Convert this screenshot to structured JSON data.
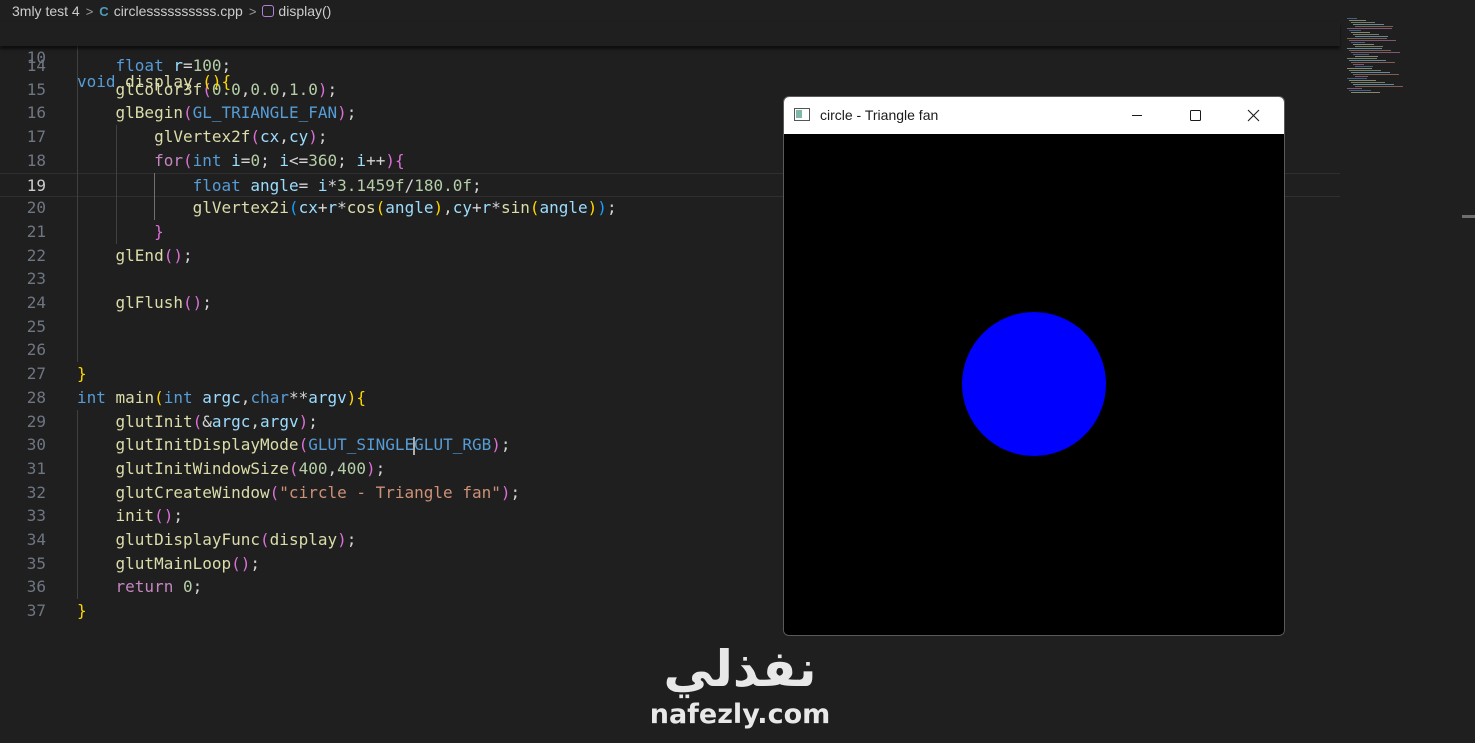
{
  "breadcrumb": {
    "folder": "3mly test 4",
    "file_icon": "C",
    "file": "circlessssssssss.cpp",
    "symbol": "display()"
  },
  "sticky": {
    "line_number": "10",
    "tokens": [
      {
        "t": "void",
        "c": "k"
      },
      {
        "t": " ",
        "c": "p"
      },
      {
        "t": "display",
        "c": "f"
      },
      {
        "t": " ",
        "c": "p"
      },
      {
        "t": "()",
        "c": "b1"
      },
      {
        "t": "{",
        "c": "b1"
      }
    ]
  },
  "editor": {
    "active_line": "19",
    "lines": [
      {
        "n": "14",
        "tokens": [
          {
            "t": "    ",
            "c": "p"
          },
          {
            "t": "float",
            "c": "k"
          },
          {
            "t": " ",
            "c": "p"
          },
          {
            "t": "r",
            "c": "v"
          },
          {
            "t": "=",
            "c": "p"
          },
          {
            "t": "100",
            "c": "n"
          },
          {
            "t": ";",
            "c": "p"
          }
        ]
      },
      {
        "n": "15",
        "tokens": [
          {
            "t": "    ",
            "c": "p"
          },
          {
            "t": "glColor3f",
            "c": "f"
          },
          {
            "t": "(",
            "c": "b2"
          },
          {
            "t": "0.0",
            "c": "n"
          },
          {
            "t": ",",
            "c": "p"
          },
          {
            "t": "0.0",
            "c": "n"
          },
          {
            "t": ",",
            "c": "p"
          },
          {
            "t": "1.0",
            "c": "n"
          },
          {
            "t": ")",
            "c": "b2"
          },
          {
            "t": ";",
            "c": "p"
          }
        ]
      },
      {
        "n": "16",
        "tokens": [
          {
            "t": "    ",
            "c": "p"
          },
          {
            "t": "glBegin",
            "c": "f"
          },
          {
            "t": "(",
            "c": "b2"
          },
          {
            "t": "GL_TRIANGLE_FAN",
            "c": "m"
          },
          {
            "t": ")",
            "c": "b2"
          },
          {
            "t": ";",
            "c": "p"
          }
        ]
      },
      {
        "n": "17",
        "tokens": [
          {
            "t": "        ",
            "c": "p"
          },
          {
            "t": "glVertex2f",
            "c": "f"
          },
          {
            "t": "(",
            "c": "b2"
          },
          {
            "t": "cx",
            "c": "v"
          },
          {
            "t": ",",
            "c": "p"
          },
          {
            "t": "cy",
            "c": "v"
          },
          {
            "t": ")",
            "c": "b2"
          },
          {
            "t": ";",
            "c": "p"
          }
        ]
      },
      {
        "n": "18",
        "tokens": [
          {
            "t": "        ",
            "c": "p"
          },
          {
            "t": "for",
            "c": "c"
          },
          {
            "t": "(",
            "c": "b2"
          },
          {
            "t": "int",
            "c": "k"
          },
          {
            "t": " ",
            "c": "p"
          },
          {
            "t": "i",
            "c": "v"
          },
          {
            "t": "=",
            "c": "p"
          },
          {
            "t": "0",
            "c": "n"
          },
          {
            "t": "; ",
            "c": "p"
          },
          {
            "t": "i",
            "c": "v"
          },
          {
            "t": "<=",
            "c": "p"
          },
          {
            "t": "360",
            "c": "n"
          },
          {
            "t": "; ",
            "c": "p"
          },
          {
            "t": "i",
            "c": "v"
          },
          {
            "t": "++",
            "c": "p"
          },
          {
            "t": ")",
            "c": "b2"
          },
          {
            "t": "{",
            "c": "b2"
          }
        ]
      },
      {
        "n": "19",
        "tokens": [
          {
            "t": "            ",
            "c": "p"
          },
          {
            "t": "float",
            "c": "k"
          },
          {
            "t": " ",
            "c": "p"
          },
          {
            "t": "angle",
            "c": "v"
          },
          {
            "t": "= ",
            "c": "p"
          },
          {
            "t": "i",
            "c": "v"
          },
          {
            "t": "*",
            "c": "p"
          },
          {
            "t": "3.1459f",
            "c": "n"
          },
          {
            "t": "/",
            "c": "p"
          },
          {
            "t": "180.0f",
            "c": "n"
          },
          {
            "t": ";",
            "c": "p"
          }
        ]
      },
      {
        "n": "20",
        "tokens": [
          {
            "t": "            ",
            "c": "p"
          },
          {
            "t": "glVertex2i",
            "c": "f"
          },
          {
            "t": "(",
            "c": "b3"
          },
          {
            "t": "cx",
            "c": "v"
          },
          {
            "t": "+",
            "c": "p"
          },
          {
            "t": "r",
            "c": "v"
          },
          {
            "t": "*",
            "c": "p"
          },
          {
            "t": "cos",
            "c": "f"
          },
          {
            "t": "(",
            "c": "b1"
          },
          {
            "t": "angle",
            "c": "v"
          },
          {
            "t": ")",
            "c": "b1"
          },
          {
            "t": ",",
            "c": "p"
          },
          {
            "t": "cy",
            "c": "v"
          },
          {
            "t": "+",
            "c": "p"
          },
          {
            "t": "r",
            "c": "v"
          },
          {
            "t": "*",
            "c": "p"
          },
          {
            "t": "sin",
            "c": "f"
          },
          {
            "t": "(",
            "c": "b1"
          },
          {
            "t": "angle",
            "c": "v"
          },
          {
            "t": ")",
            "c": "b1"
          },
          {
            "t": ")",
            "c": "b3"
          },
          {
            "t": ";",
            "c": "p"
          }
        ]
      },
      {
        "n": "21",
        "tokens": [
          {
            "t": "        ",
            "c": "p"
          },
          {
            "t": "}",
            "c": "b2"
          }
        ]
      },
      {
        "n": "22",
        "tokens": [
          {
            "t": "    ",
            "c": "p"
          },
          {
            "t": "glEnd",
            "c": "f"
          },
          {
            "t": "()",
            "c": "b2"
          },
          {
            "t": ";",
            "c": "p"
          }
        ]
      },
      {
        "n": "23",
        "tokens": []
      },
      {
        "n": "24",
        "tokens": [
          {
            "t": "    ",
            "c": "p"
          },
          {
            "t": "glFlush",
            "c": "f"
          },
          {
            "t": "()",
            "c": "b2"
          },
          {
            "t": ";",
            "c": "p"
          }
        ]
      },
      {
        "n": "25",
        "tokens": []
      },
      {
        "n": "26",
        "tokens": []
      },
      {
        "n": "27",
        "tokens": [
          {
            "t": "}",
            "c": "b1"
          }
        ]
      },
      {
        "n": "28",
        "tokens": [
          {
            "t": "int",
            "c": "k"
          },
          {
            "t": " ",
            "c": "p"
          },
          {
            "t": "main",
            "c": "f"
          },
          {
            "t": "(",
            "c": "b1"
          },
          {
            "t": "int",
            "c": "k"
          },
          {
            "t": " ",
            "c": "p"
          },
          {
            "t": "argc",
            "c": "v"
          },
          {
            "t": ",",
            "c": "p"
          },
          {
            "t": "char",
            "c": "k"
          },
          {
            "t": "**",
            "c": "p"
          },
          {
            "t": "argv",
            "c": "v"
          },
          {
            "t": ")",
            "c": "b1"
          },
          {
            "t": "{",
            "c": "b1"
          }
        ]
      },
      {
        "n": "29",
        "tokens": [
          {
            "t": "    ",
            "c": "p"
          },
          {
            "t": "glutInit",
            "c": "f"
          },
          {
            "t": "(",
            "c": "b2"
          },
          {
            "t": "&",
            "c": "p"
          },
          {
            "t": "argc",
            "c": "v"
          },
          {
            "t": ",",
            "c": "p"
          },
          {
            "t": "argv",
            "c": "v"
          },
          {
            "t": ")",
            "c": "b2"
          },
          {
            "t": ";",
            "c": "p"
          }
        ]
      },
      {
        "n": "30",
        "tokens": [
          {
            "t": "    ",
            "c": "p"
          },
          {
            "t": "glutInitDisplayMode",
            "c": "f"
          },
          {
            "t": "(",
            "c": "b2"
          },
          {
            "t": "GLUT_SINGLE",
            "c": "m"
          },
          {
            "t": "|",
            "caret": true
          },
          {
            "t": "GLUT_RGB",
            "c": "m"
          },
          {
            "t": ")",
            "c": "b2"
          },
          {
            "t": ";",
            "c": "p"
          }
        ]
      },
      {
        "n": "31",
        "tokens": [
          {
            "t": "    ",
            "c": "p"
          },
          {
            "t": "glutInitWindowSize",
            "c": "f"
          },
          {
            "t": "(",
            "c": "b2"
          },
          {
            "t": "400",
            "c": "n"
          },
          {
            "t": ",",
            "c": "p"
          },
          {
            "t": "400",
            "c": "n"
          },
          {
            "t": ")",
            "c": "b2"
          },
          {
            "t": ";",
            "c": "p"
          }
        ]
      },
      {
        "n": "32",
        "tokens": [
          {
            "t": "    ",
            "c": "p"
          },
          {
            "t": "glutCreateWindow",
            "c": "f"
          },
          {
            "t": "(",
            "c": "b2"
          },
          {
            "t": "\"circle - Triangle fan\"",
            "c": "s"
          },
          {
            "t": ")",
            "c": "b2"
          },
          {
            "t": ";",
            "c": "p"
          }
        ]
      },
      {
        "n": "33",
        "tokens": [
          {
            "t": "    ",
            "c": "p"
          },
          {
            "t": "init",
            "c": "f"
          },
          {
            "t": "()",
            "c": "b2"
          },
          {
            "t": ";",
            "c": "p"
          }
        ]
      },
      {
        "n": "34",
        "tokens": [
          {
            "t": "    ",
            "c": "p"
          },
          {
            "t": "glutDisplayFunc",
            "c": "f"
          },
          {
            "t": "(",
            "c": "b2"
          },
          {
            "t": "display",
            "c": "f"
          },
          {
            "t": ")",
            "c": "b2"
          },
          {
            "t": ";",
            "c": "p"
          }
        ]
      },
      {
        "n": "35",
        "tokens": [
          {
            "t": "    ",
            "c": "p"
          },
          {
            "t": "glutMainLoop",
            "c": "f"
          },
          {
            "t": "()",
            "c": "b2"
          },
          {
            "t": ";",
            "c": "p"
          }
        ]
      },
      {
        "n": "36",
        "tokens": [
          {
            "t": "    ",
            "c": "p"
          },
          {
            "t": "return",
            "c": "c"
          },
          {
            "t": " ",
            "c": "p"
          },
          {
            "t": "0",
            "c": "n"
          },
          {
            "t": ";",
            "c": "p"
          }
        ]
      },
      {
        "n": "37",
        "tokens": [
          {
            "t": "}",
            "c": "b1"
          }
        ]
      }
    ]
  },
  "glut_window": {
    "title": "circle - Triangle fan",
    "background": "#000000",
    "circle_color": "#0000ff"
  },
  "watermark": {
    "arabic": "نفذلي",
    "latin": "nafezly.com"
  },
  "colors": {
    "editor_bg": "#1f1f1f",
    "keyword": "#569cd6",
    "function": "#dcdcaa",
    "number": "#b5cea8",
    "string": "#ce9178",
    "variable": "#9cdcfe"
  }
}
